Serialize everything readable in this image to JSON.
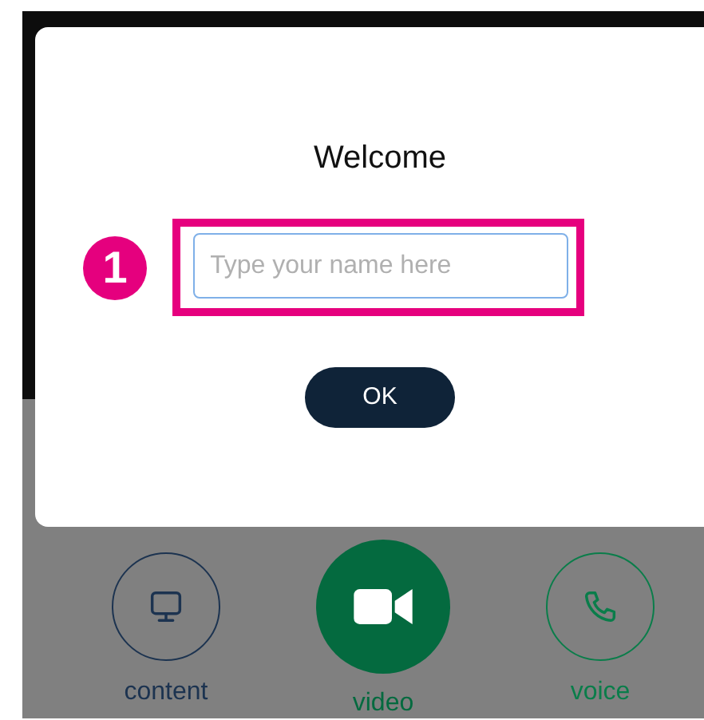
{
  "dialog": {
    "title": "Welcome",
    "name_field": {
      "placeholder": "Type your name here"
    },
    "ok_button": "OK"
  },
  "callout": {
    "number": "1"
  },
  "call_buttons": [
    {
      "kind": "content",
      "label": "content",
      "selected": false,
      "color": "#1c3350"
    },
    {
      "kind": "video",
      "label": "video",
      "selected": true,
      "color": "#046a3f"
    },
    {
      "kind": "voice",
      "label": "voice",
      "selected": false,
      "color": "#0a7d4a"
    }
  ]
}
